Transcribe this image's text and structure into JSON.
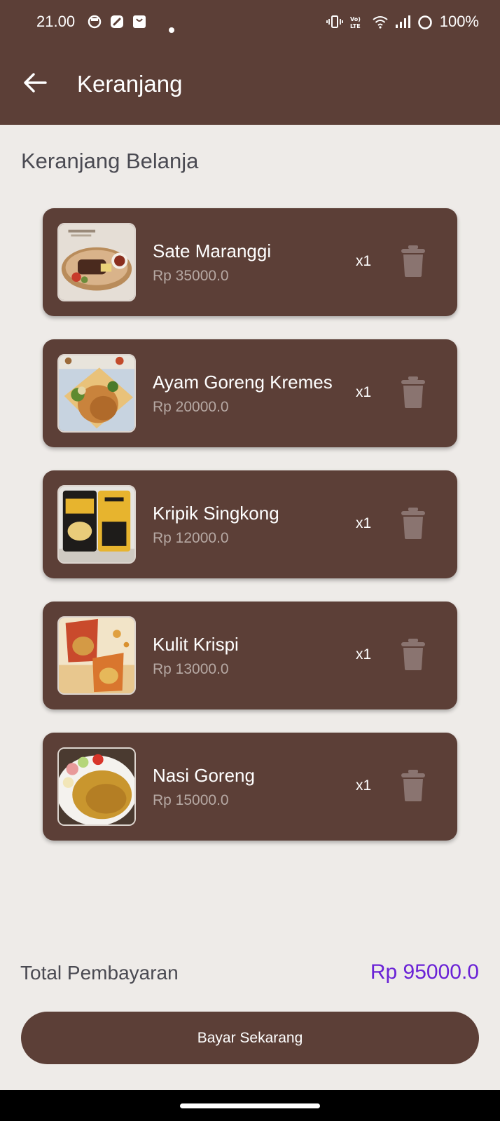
{
  "status_bar": {
    "time": "21.00",
    "battery": "100%",
    "lte_label": "Vo) LTE"
  },
  "app_bar": {
    "title": "Keranjang",
    "back_icon": "arrow-left-icon"
  },
  "section_title": "Keranjang Belanja",
  "cart": {
    "items": [
      {
        "name": "Sate Maranggi",
        "price": "Rp 35000.0",
        "qty": "x1",
        "image": "sate-maranggi-photo"
      },
      {
        "name": "Ayam Goreng Kremes",
        "price": "Rp 20000.0",
        "qty": "x1",
        "image": "ayam-goreng-kremes-photo"
      },
      {
        "name": "Kripik Singkong",
        "price": "Rp 12000.0",
        "qty": "x1",
        "image": "kripik-singkong-photo"
      },
      {
        "name": "Kulit Krispi",
        "price": "Rp 13000.0",
        "qty": "x1",
        "image": "kulit-krispi-photo"
      },
      {
        "name": "Nasi Goreng",
        "price": "Rp 15000.0",
        "qty": "x1",
        "image": "nasi-goreng-photo"
      }
    ]
  },
  "total": {
    "label": "Total Pembayaran",
    "value": "Rp 95000.0"
  },
  "pay_button": {
    "label": "Bayar Sekarang"
  },
  "colors": {
    "primary": "#5C3F37",
    "background": "#EEEBE8",
    "total_accent": "#6A22D6",
    "price_text": "#B6A8A3",
    "trash_icon": "#8A7470"
  }
}
